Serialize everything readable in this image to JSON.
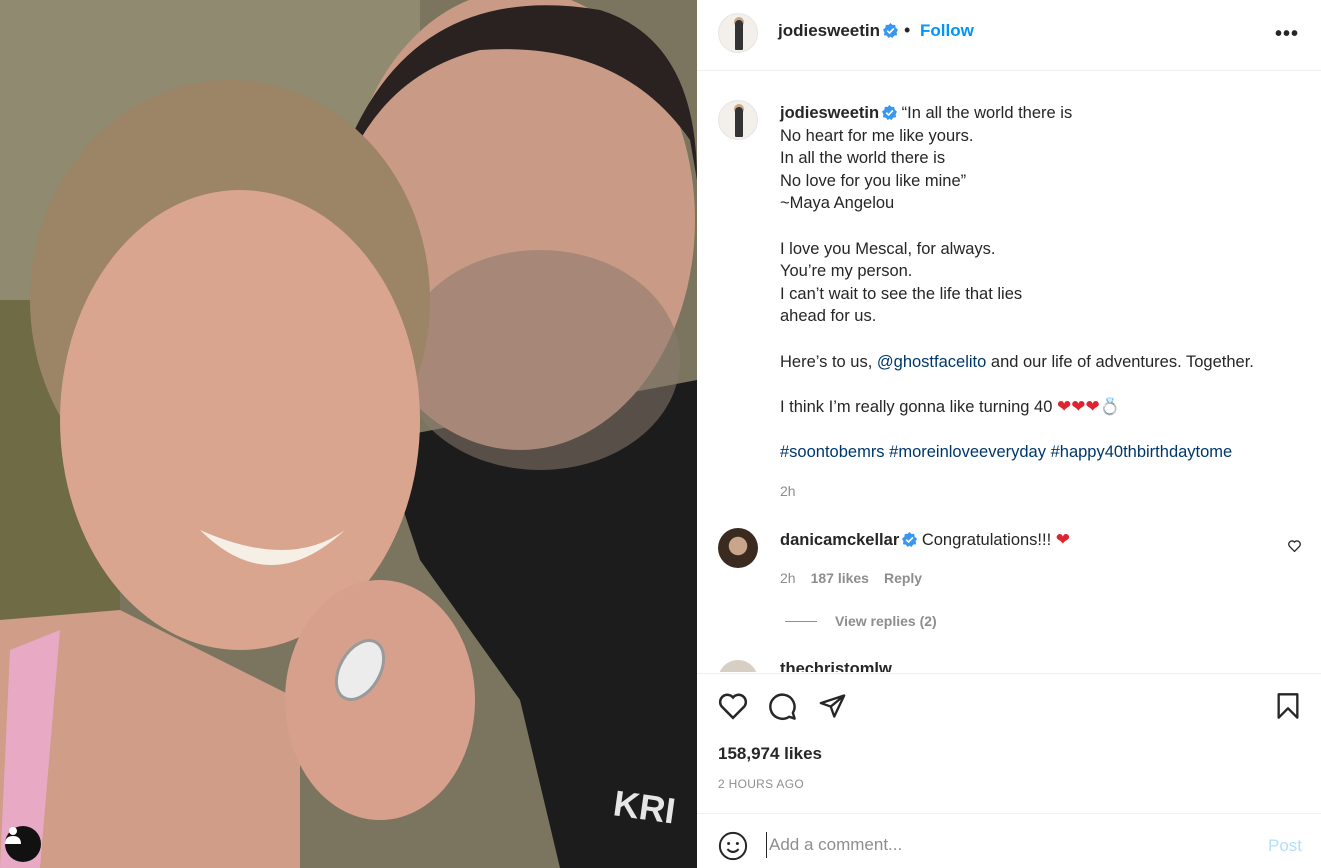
{
  "post": {
    "username": "jodiesweetin",
    "follow_label": "Follow",
    "separator": "•",
    "more_label": "•••"
  },
  "caption": {
    "username": "jodiesweetin",
    "lines_1": [
      "“In all the world there is",
      "No heart for me like yours.",
      "In all the world there is",
      "No love for you like mine”",
      "~Maya Angelou"
    ],
    "lines_2": [
      "I love you Mescal, for always.",
      "You’re my person.",
      "I can’t wait to see the life that lies",
      "ahead for us."
    ],
    "here_prefix": "Here’s to us, ",
    "mention": "@ghostfacelito",
    "here_suffix": " and our life of adventures. Together.",
    "birthday_text": "I think I’m really gonna like turning 40 ",
    "birthday_emojis": "❤❤❤",
    "ring_emoji": "💍",
    "hashtags": [
      "#soontobemrs",
      "#moreinloveeveryday",
      "#happy40thbirthdaytome"
    ],
    "time": "2h"
  },
  "comment": {
    "username": "danicamckellar",
    "text": "Congratulations!!! ",
    "emoji": "❤",
    "time": "2h",
    "likes": "187 likes",
    "reply_label": "Reply",
    "view_replies": "View replies (2)"
  },
  "cut_comment": {
    "text": "thechristomlw"
  },
  "actions": {
    "likes": "158,974 likes",
    "ago": "2 HOURS AGO"
  },
  "add_comment": {
    "placeholder": "Add a comment...",
    "post_label": "Post"
  },
  "colors": {
    "link": "#00376b",
    "follow": "#0095f6",
    "verified": "#3897f0",
    "muted": "#8e8e8e"
  }
}
